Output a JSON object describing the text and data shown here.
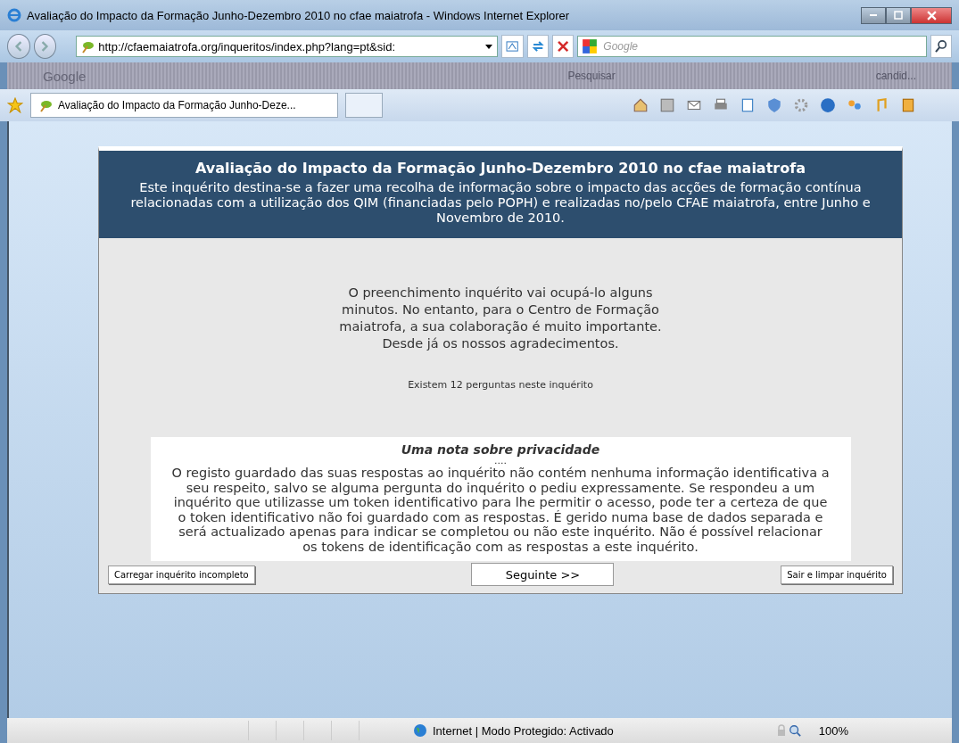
{
  "window": {
    "title": "Avaliação do Impacto da Formação Junho-Dezembro 2010 no cfae maiatrofa - Windows Internet Explorer"
  },
  "address": {
    "value": "http://cfaemaiatrofa.org/inqueritos/index.php?lang=pt&sid:"
  },
  "search": {
    "placeholder": "Google"
  },
  "google_toolbar": {
    "items": [
      "Google",
      "Pesquisar",
      "candid..."
    ]
  },
  "tab": {
    "label": "Avaliação do Impacto da Formação Junho-Deze...",
    "selected": true
  },
  "survey": {
    "title": "Avaliação do Impacto da Formação Junho-Dezembro 2010 no cfae maiatrofa",
    "description": "Este inquérito destina-se a fazer uma recolha de informação sobre o impacto das acções de formação contínua relacionadas com a utilização dos QIM (financiadas pelo POPH) e realizadas no/pelo CFAE maiatrofa, entre Junho e Novembro de 2010.",
    "welcome": "O preenchimento inquérito vai ocupá-lo alguns minutos. No entanto, para o Centro de Formação maiatrofa, a sua colaboração é muito importante. Desde já os nossos agradecimentos.",
    "question_count": "Existem 12 perguntas neste inquérito",
    "privacy_title": "Uma nota sobre privacidade",
    "privacy_dots": "....",
    "privacy_text": "O registo guardado das suas respostas ao inquérito não contém nenhuma informação identificativa a seu respeito, salvo se alguma pergunta do inquérito o pediu expressamente. Se respondeu a um inquérito que utilizasse um token identificativo para lhe permitir o acesso, pode ter a certeza de que o token identificativo não foi guardado com as respostas. É gerido numa base de dados separada e será actualizado apenas para indicar se completou ou não este inquérito. Não é possível relacionar os tokens de identificação com as respostas a este inquérito.",
    "buttons": [
      {
        "label": "Carregar inquérito incompleto",
        "kind": "small"
      },
      {
        "label": "Seguinte >>",
        "kind": "main"
      },
      {
        "label": "Sair e limpar inquérito",
        "kind": "small"
      }
    ]
  },
  "status_bar": {
    "zone": "Internet | Modo Protegido: Activado",
    "zoom": "100%"
  }
}
